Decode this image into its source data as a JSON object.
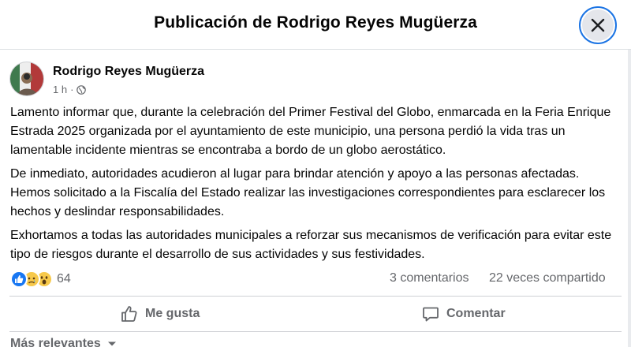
{
  "header": {
    "title": "Publicación de Rodrigo Reyes Mugüerza"
  },
  "post": {
    "author": "Rodrigo Reyes Mugüerza",
    "time": "1 h",
    "separator": "·",
    "paragraphs": [
      "Lamento informar que, durante la celebración del Primer Festival del Globo, enmarcada en la Feria Enrique Estrada 2025 organizada por el ayuntamiento de este municipio, una persona perdió la vida tras un lamentable incidente mientras se encontraba a bordo de un globo aerostático.",
      "De inmediato, autoridades acudieron al lugar para brindar atención y apoyo a las personas afectadas. Hemos solicitado a la Fiscalía del Estado realizar las investigaciones correspondientes para esclarecer los hechos y deslindar responsabilidades.",
      "Exhortamos a todas las autoridades municipales a reforzar sus mecanismos de verificación para evitar este tipo de riesgos durante el desarrollo de sus actividades y sus festividades."
    ]
  },
  "stats": {
    "reactions": [
      "like-icon",
      "sad-icon",
      "wow-icon"
    ],
    "reaction_count": "64",
    "comments": "3 comentarios",
    "shares": "22 veces compartido"
  },
  "actions": {
    "like_label": "Me gusta",
    "comment_label": "Comentar"
  },
  "comments_sort": {
    "label": "Más relevantes"
  },
  "colors": {
    "accent": "#1877f2",
    "secondary_text": "#65676b",
    "emoji_yellow": "#f7c94b",
    "focus_ring": "#1b74e4"
  }
}
